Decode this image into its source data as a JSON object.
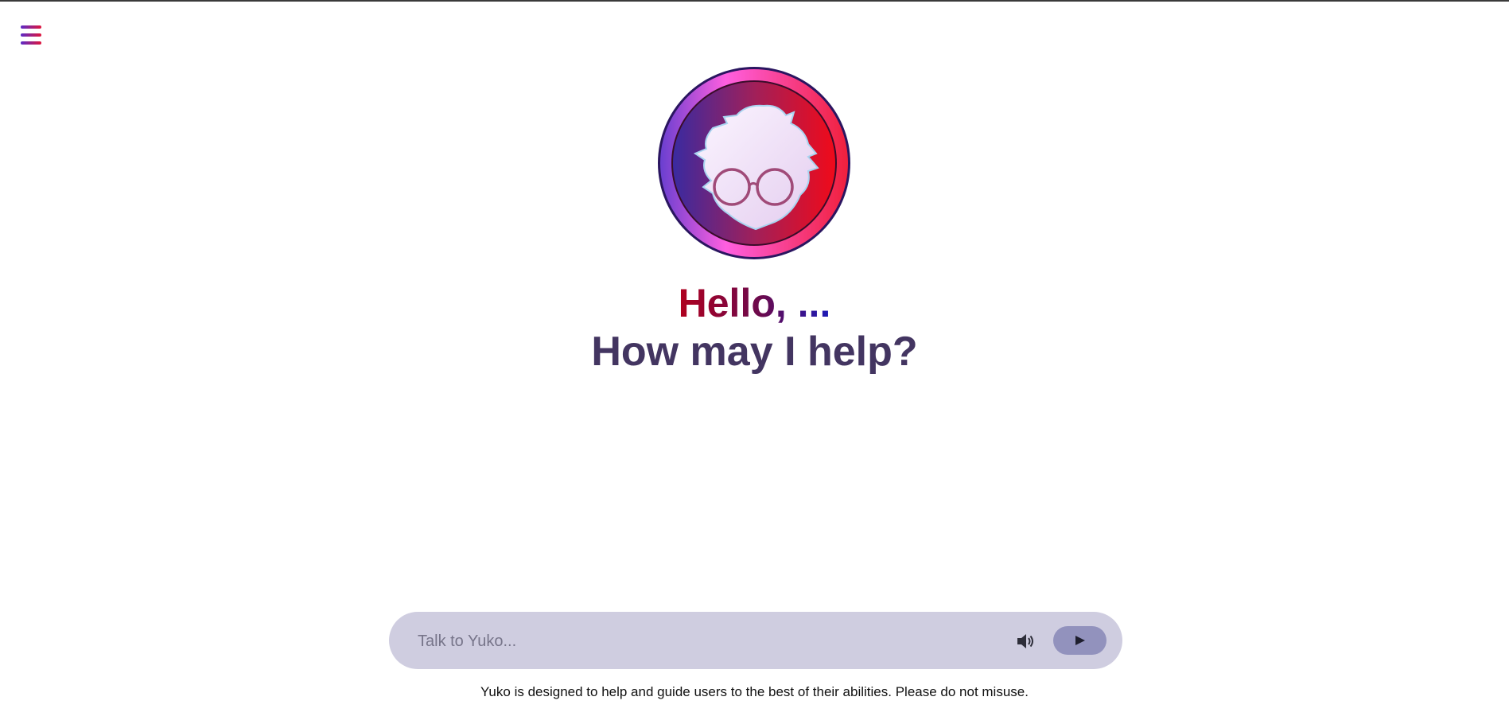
{
  "header": {
    "menu_icon": "hamburger-menu-icon"
  },
  "avatar": {
    "icon": "yuko-avatar-logo"
  },
  "hero": {
    "greeting": "Hello, ...",
    "subtitle": "How may I help?"
  },
  "chat": {
    "placeholder": "Talk to Yuko...",
    "value": "",
    "speaker_icon": "speaker-icon",
    "send_icon": "send-arrow-icon"
  },
  "footer": {
    "disclaimer": "Yuko is designed to help and guide users to the best of their abilities. Please do not misuse."
  },
  "colors": {
    "accent_red": "#e0163c",
    "accent_purple": "#5b2bc8",
    "subtitle": "#433561",
    "chat_bg": "#cfcde0",
    "send_bg": "#9292bd"
  }
}
